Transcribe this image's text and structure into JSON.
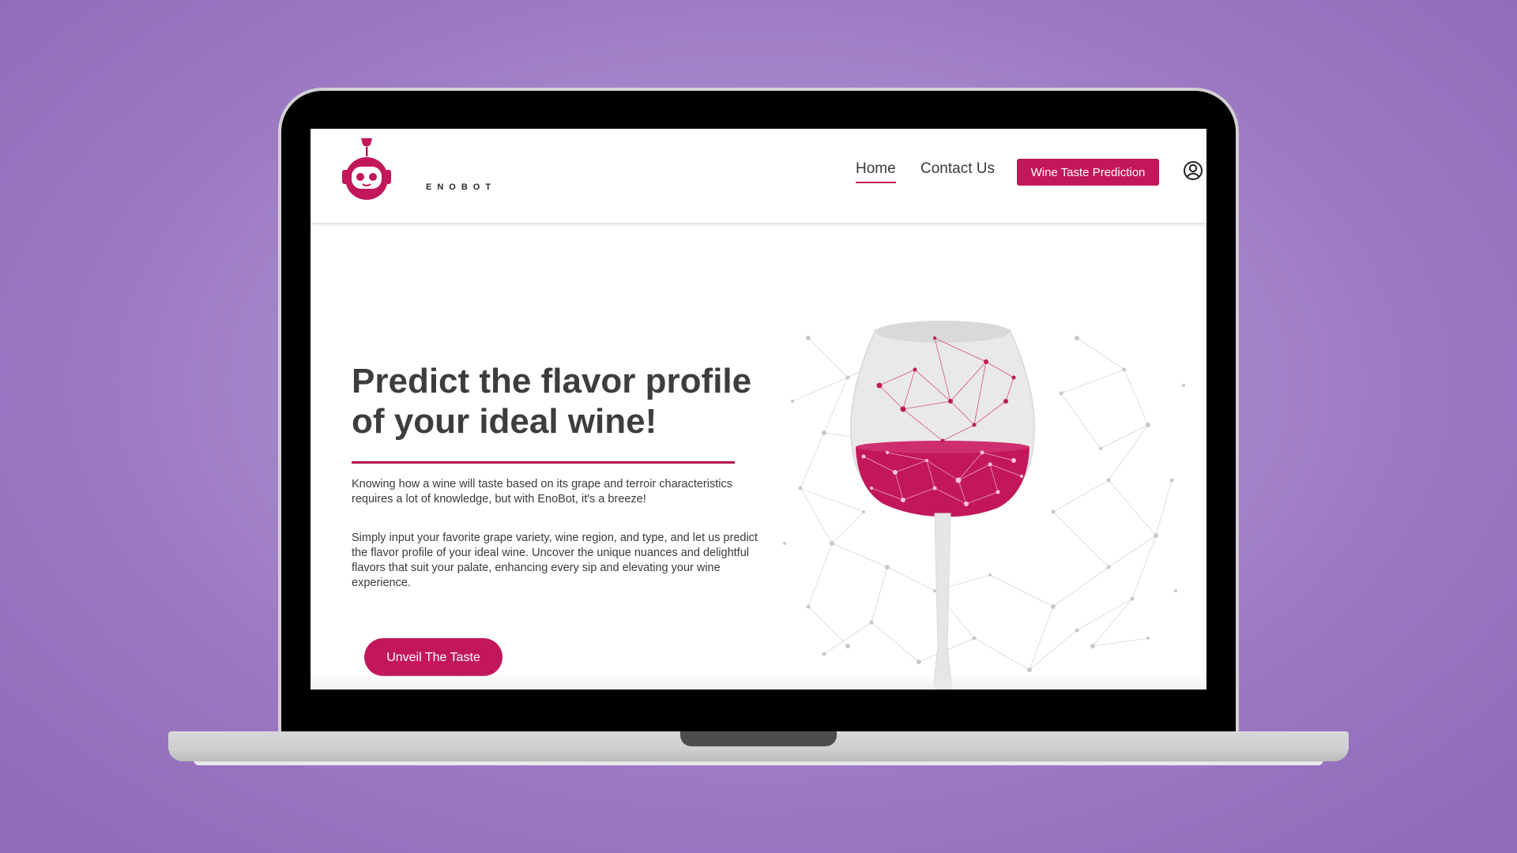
{
  "brand": {
    "name": "ENOBOT",
    "accent_color": "#c2185b"
  },
  "nav": {
    "home_label": "Home",
    "contact_label": "Contact Us",
    "cta_label": "Wine Taste Prediction",
    "account_icon": "user-circle-icon"
  },
  "hero": {
    "title_line1": "Predict the flavor profile",
    "title_line2": "of your ideal wine!",
    "paragraph1": "Knowing how a wine will taste based on its grape and terroir characteristics requires a lot of knowledge, but with EnoBot, it's a breeze!",
    "paragraph2": "Simply input your favorite grape variety, wine region, and type, and let us predict the flavor profile of your ideal wine. Uncover the unique nuances and delightful flavors that suit your palate, enhancing every sip and elevating your wine experience.",
    "cta_label": "Unveil The Taste",
    "illustration_icon": "wine-glass-network-icon"
  }
}
